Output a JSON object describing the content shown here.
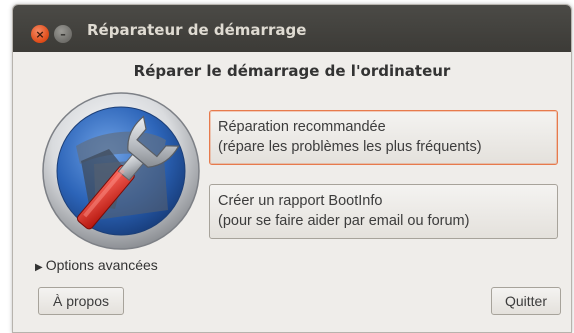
{
  "window": {
    "title": "Réparateur de démarrage",
    "close_glyph": "×",
    "minimize_glyph": "–"
  },
  "main": {
    "heading": "Réparer le démarrage de l'ordinateur",
    "logo_icon": "wrench-gear-icon",
    "recommended_repair": {
      "line1": "Réparation recommandée",
      "line2": "(répare les problèmes les plus fréquents)"
    },
    "bootinfo": {
      "line1": "Créer un rapport BootInfo",
      "line2": "(pour se faire aider par email ou forum)"
    },
    "advanced_options": "Options avancées",
    "advanced_arrow": "▶"
  },
  "footer": {
    "about": "À propos",
    "quit": "Quitter"
  },
  "colors": {
    "titlebar": "#3c3b37",
    "close": "#df4a16",
    "focus": "#e77a4c",
    "window_bg": "#efedea"
  }
}
